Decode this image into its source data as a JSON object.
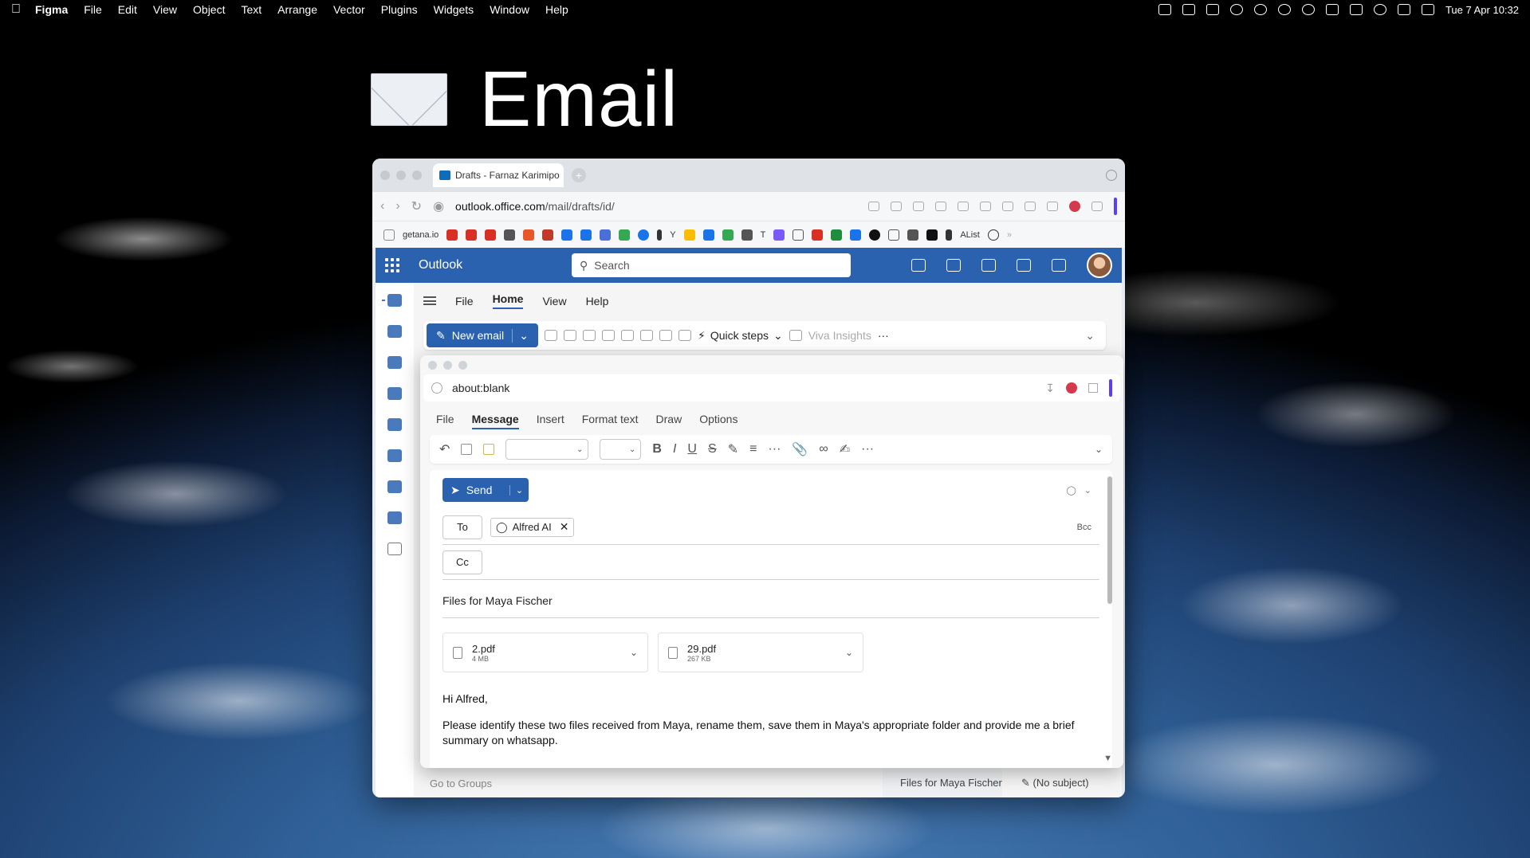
{
  "menubar": {
    "app": "Figma",
    "items": [
      "File",
      "Edit",
      "View",
      "Object",
      "Text",
      "Arrange",
      "Vector",
      "Plugins",
      "Widgets",
      "Window",
      "Help"
    ],
    "clock": "Tue 7 Apr  10:32"
  },
  "hero": {
    "title": "Email"
  },
  "browser": {
    "tab_title": "Drafts - Farnaz Karimipo",
    "url_domain": "outlook.office.com",
    "url_path": "/mail/drafts/id/",
    "bookmarks": [
      "getana.io",
      "Y",
      "T",
      "AList"
    ]
  },
  "outlook": {
    "app_title": "Outlook",
    "search_placeholder": "Search",
    "ribbon_tabs": [
      "File",
      "Home",
      "View",
      "Help"
    ],
    "new_email": "New email",
    "quick_steps": "Quick steps",
    "viva": "Viva Insights",
    "more": "···",
    "go_to_groups": "Go to Groups",
    "status_tab_1": "Files for Maya Fischer",
    "status_tab_2": "(No subject)"
  },
  "compose": {
    "address": "about:blank",
    "tabs": [
      "File",
      "Message",
      "Insert",
      "Format text",
      "Draw",
      "Options"
    ],
    "send": "Send",
    "to_label": "To",
    "cc_label": "Cc",
    "bcc": "Bcc",
    "recipient": "Alfred AI",
    "subject": "Files for Maya Fischer",
    "attachments": [
      {
        "name": "2.pdf",
        "size": "4 MB"
      },
      {
        "name": "29.pdf",
        "size": "267 KB"
      }
    ],
    "greeting": "Hi Alfred,",
    "body": "Please identify these two files received from Maya, rename them, save them in Maya's appropriate folder and provide me a brief summary on whatsapp."
  }
}
